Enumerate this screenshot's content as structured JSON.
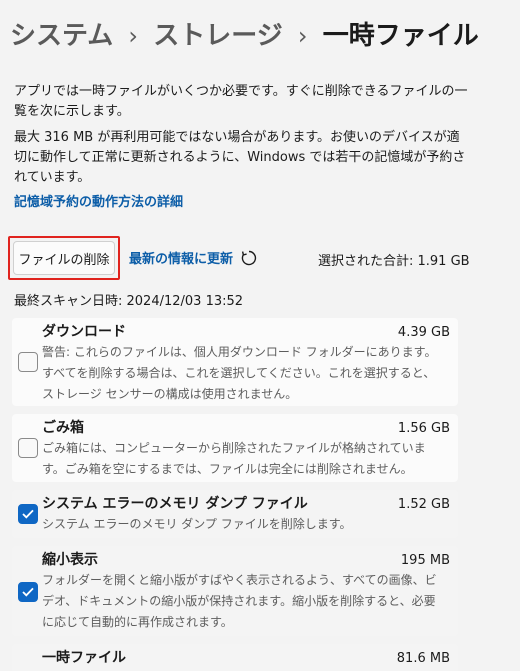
{
  "breadcrumb": {
    "items": [
      "システム",
      "ストレージ"
    ],
    "current": "一時ファイル"
  },
  "description": "アプリでは一時ファイルがいくつか必要です。すぐに削除できるファイルの一覧を次に示します。",
  "reserve_note": "最大 316 MB が再利用可能ではない場合があります。お使いのデバイスが適切に動作して正常に更新されるように、Windows では若干の記憶域が予約されています。",
  "reserve_link": "記憶域予約の動作方法の詳細",
  "toolbar": {
    "delete_label": "ファイルの削除",
    "refresh_label": "最新の情報に更新",
    "total_label": "選択された合計: 1.91 GB"
  },
  "last_scan": "最終スキャン日時: 2024/12/03 13:52",
  "items": [
    {
      "title": "ダウンロード",
      "size": "4.39 GB",
      "checked": false,
      "desc": "警告: これらのファイルは、個人用ダウンロード フォルダーにあります。すべてを削除する場合は、これを選択してください。これを選択すると、ストレージ センサーの構成は使用されません。"
    },
    {
      "title": "ごみ箱",
      "size": "1.56 GB",
      "checked": false,
      "desc": "ごみ箱には、コンピューターから削除されたファイルが格納されています。ごみ箱を空にするまでは、ファイルは完全には削除されません。"
    },
    {
      "title": "システム エラーのメモリ ダンプ ファイル",
      "size": "1.52 GB",
      "checked": true,
      "desc": "システム エラーのメモリ ダンプ ファイルを削除します。"
    },
    {
      "title": "縮小表示",
      "size": "195 MB",
      "checked": true,
      "desc": "フォルダーを開くと縮小版がすばやく表示されるよう、すべての画像、ビデオ、ドキュメントの縮小版が保持されます。縮小版を削除すると、必要に応じて自動的に再作成されます。"
    },
    {
      "title": "一時ファイル",
      "size": "81.6 MB",
      "checked": true,
      "desc": ""
    }
  ],
  "colors": {
    "accent": "#0f67c4",
    "link": "#0d5ea8",
    "highlight": "#e0231e"
  },
  "icons": {
    "refresh": "refresh-icon",
    "check": "checkmark-icon"
  }
}
